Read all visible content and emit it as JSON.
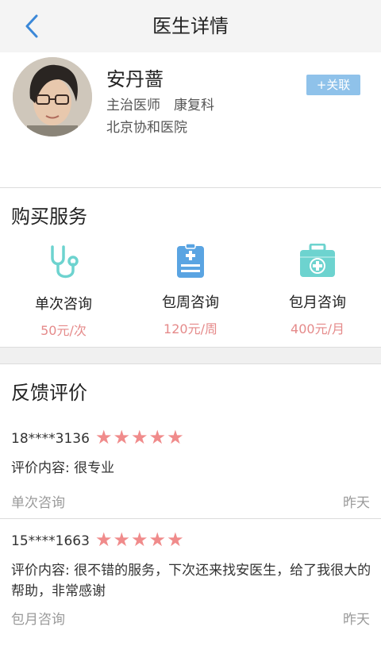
{
  "header": {
    "title": "医生详情"
  },
  "doctor": {
    "name": "安丹蔷",
    "title_dept": "主治医师　康复科",
    "hospital": "北京协和医院",
    "follow_label": "+关联"
  },
  "services": {
    "title": "购买服务",
    "items": [
      {
        "icon": "stethoscope-icon",
        "label": "单次咨询",
        "price": "50元/次"
      },
      {
        "icon": "clipboard-icon",
        "label": "包周咨询",
        "price": "120元/周"
      },
      {
        "icon": "medical-kit-icon",
        "label": "包月咨询",
        "price": "400元/月"
      }
    ],
    "colors": {
      "icon_teal": "#6dd3cf",
      "icon_blue": "#5aa4e2",
      "price": "#e58a8a"
    }
  },
  "feedback": {
    "title": "反馈评价",
    "reviews": [
      {
        "user": "18****3136",
        "rating": 5,
        "stars": "★★★★★",
        "content": "评价内容: 很专业",
        "type": "单次咨询",
        "time": "昨天"
      },
      {
        "user": "15****1663",
        "rating": 5,
        "stars": "★★★★★",
        "content": "评价内容: 很不错的服务，下次还来找安医生，给了我很大的帮助，非常感谢",
        "type": "包月咨询",
        "time": "昨天"
      }
    ]
  }
}
